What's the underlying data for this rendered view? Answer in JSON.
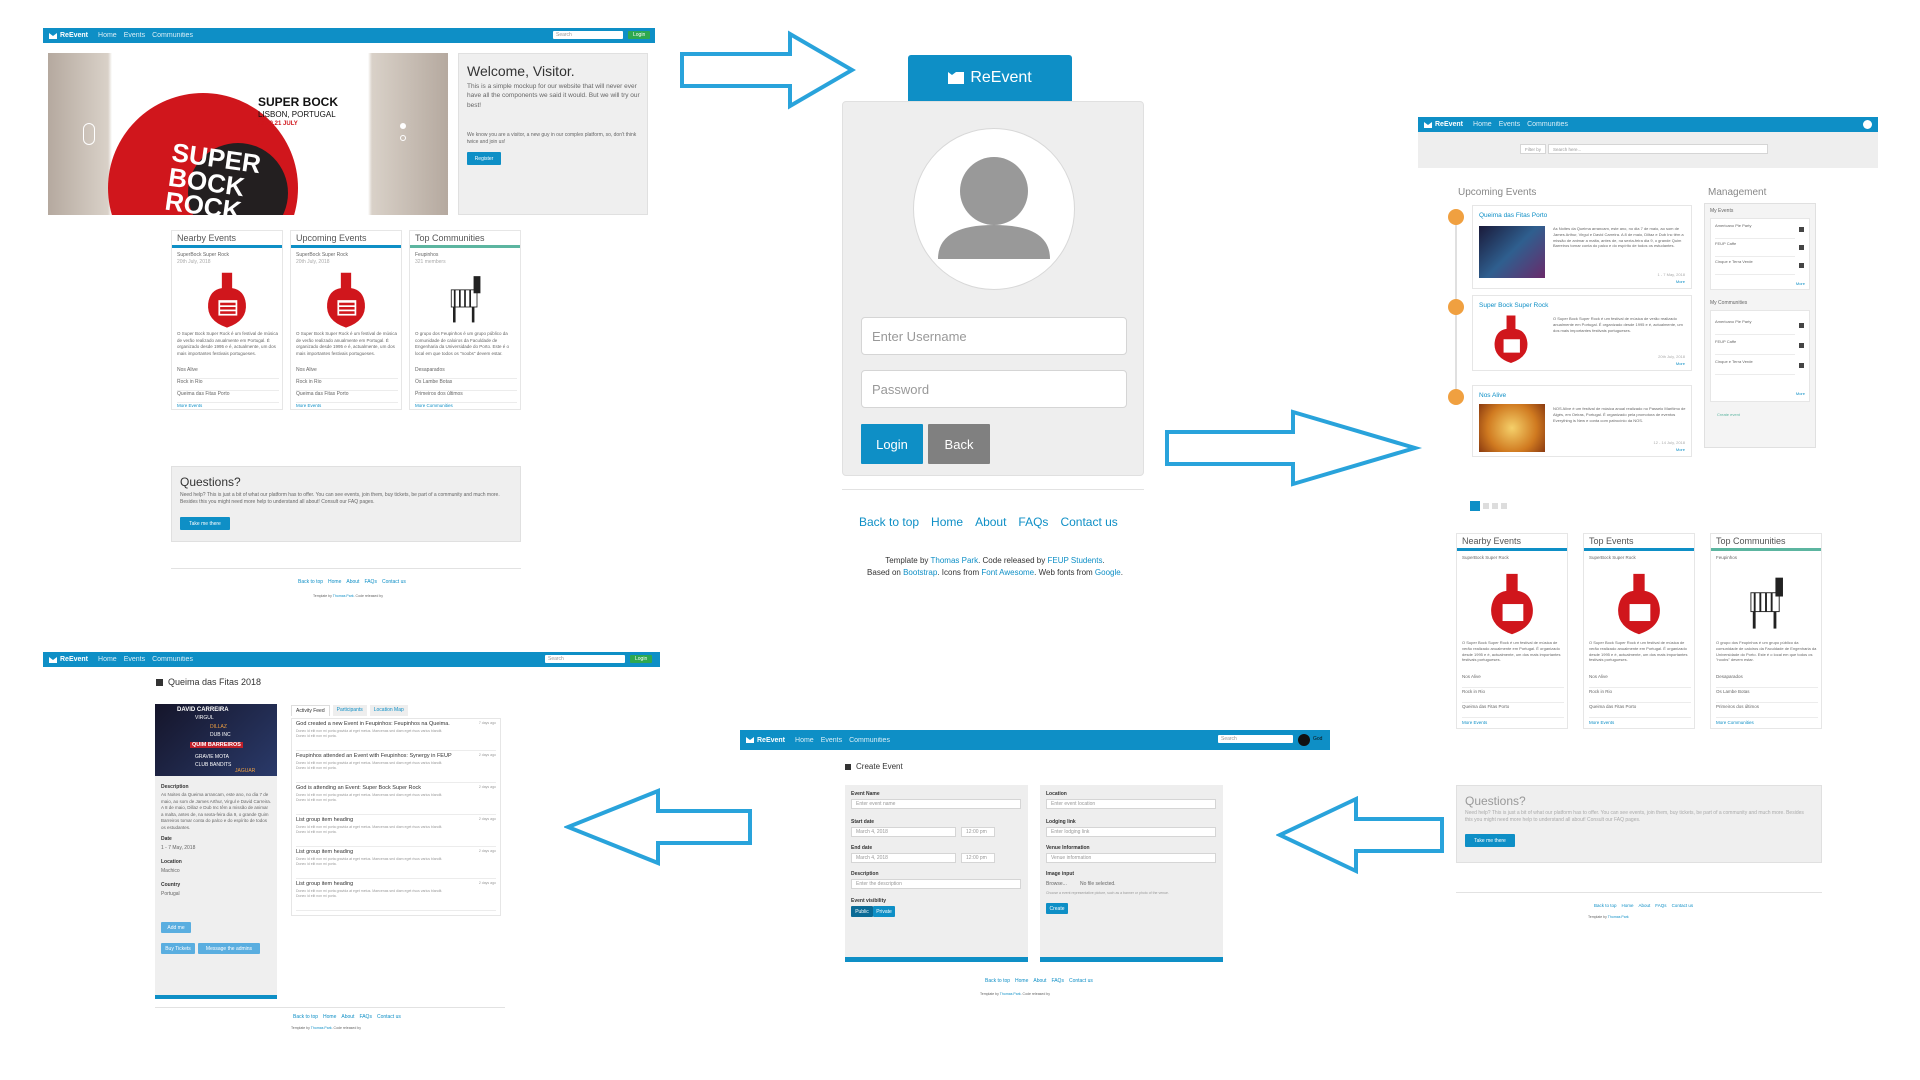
{
  "app": {
    "brand": "ReEvent",
    "nav_links": [
      "Home",
      "Events",
      "Communities"
    ],
    "search_placeholder": "Search",
    "go_label": "Login"
  },
  "home": {
    "hero": {
      "title": "SUPER BOCK",
      "subtitle": "LISBON, PORTUGAL",
      "dates": "19.20.21 JULY",
      "big_text": "SUPER BOCK ROCK"
    },
    "welcome": {
      "title": "Welcome, Visitor.",
      "text": "This is a simple mockup for our website that will never ever have all the components we said it would. But we will try our best!",
      "text2": "We know you are a visitor, a new guy in our complex platform, so, don't think twice and join us!",
      "button": "Register"
    },
    "cards": [
      {
        "title": "Nearby Events",
        "item": "SuperBock Super Rock",
        "date": "20th July, 2018",
        "desc": "O Super Bock Super Rock é um festival de música de verão realizado anualmente em Portugal. É organizado desde 1995 e é, actualmente, um dos mais importantes festivais portugueses.",
        "links": [
          "Nos Alive",
          "Rock in Rio",
          "Queima das Fitas Porto"
        ],
        "more": "More Events"
      },
      {
        "title": "Upcoming Events",
        "item": "SuperBock Super Rock",
        "date": "20th July, 2018",
        "desc": "O Super Bock Super Rock é um festival de música de verão realizado anualmente em Portugal. É organizado desde 1995 e é, actualmente, um dos mais importantes festivais portugueses.",
        "links": [
          "Nos Alive",
          "Rock in Rio",
          "Queima das Fitas Porto"
        ],
        "more": "More Events"
      },
      {
        "title": "Top Communities",
        "item": "Feupinhos",
        "date": "321 members",
        "desc": "O grupo dos Feupinhos é um grupo público da comunidade de caloiros da Faculdade de Engenharia da Universidade do Porto. Este é o local em que todos os \"noobs\" devem estar.",
        "links": [
          "Desaparados",
          "Os Lambe Botas",
          "Primeiros dos últimos"
        ],
        "more": "More Communities"
      }
    ],
    "questions": {
      "title": "Questions?",
      "text": "Need help? This is just a bit of what our platform has to offer. You can see events, join them, buy tickets, be part of a community and much more. Besides this you might need more help to understand all about! Consult our FAQ pages.",
      "button": "Take me there"
    }
  },
  "login": {
    "brand": "ReEvent",
    "username_placeholder": "Enter Username",
    "password_placeholder": "Password",
    "login_button": "Login",
    "back_button": "Back",
    "footer_links": [
      "Back to top",
      "Home",
      "About",
      "FAQs",
      "Contact us"
    ],
    "credit_prefix": "Template by",
    "credit_author": "Thomas Park",
    "credit_mid": ". Code released by",
    "credit_feup": "FEUP Students",
    "credit_line2_a": "Based on",
    "credit_bootstrap": "Bootstrap",
    "credit_line2_b": ". Icons from",
    "credit_fa": "Font Awesome",
    "credit_line2_c": ". Web fonts from",
    "credit_google": "Google"
  },
  "dashboard": {
    "filter": "Filter by",
    "search_placeholder": "Search here...",
    "upcoming_title": "Upcoming Events",
    "management_title": "Management",
    "timeline": [
      {
        "title": "Queima das Fitas Porto",
        "desc": "As Noites da Queima arrancam, este ano, no dia 7 de maio, ao som de James Arthur, Virgul e David Carreira. A 8 de maio, Diltaz e Dub Inc têm a missão de animar a malta, antes de, na sexta-feira dia 9, o grande Quim Barreiros tornar conta do palco e do espírito de todos os estudantes.",
        "date": "1 - 7 May, 2018",
        "more": "More"
      },
      {
        "title": "Super Bock Super Rock",
        "desc": "O Super Bock Super Rock é um festival de música de verão realizado anualmente em Portugal. É organizado desde 1995 e é, actualmente, um dos mais importantes festivais portugueses.",
        "date": "20th July, 2018",
        "more": "More"
      },
      {
        "title": "Nos Alive",
        "desc": "NOS Alive é um festival de música anual realizado no Passeio Marítimo de Algés, em Oeiras, Portugal. É organizado pela promotora de eventos Everything is New e conta com patrocínio da NOS.",
        "date": "12 - 14 July, 2018",
        "more": "More"
      }
    ],
    "my_events_title": "My Events",
    "my_events": [
      "Americano Pie Party",
      "FEUP Caffe",
      "Cinque e Terra Verde"
    ],
    "my_communities_title": "My Communities",
    "my_communities": [
      "Americano Pie Party",
      "FEUP Caffe",
      "Cinque e Terra Verde"
    ],
    "more": "More",
    "create_label": "Create event",
    "cards": [
      "Nearby Events",
      "Top Events",
      "Top Communities"
    ],
    "questions_title": "Questions?",
    "questions_button": "Take me there"
  },
  "event_page": {
    "title": "Queima das Fitas 2018",
    "poster_lines": [
      "DAVID CARREIRA",
      "VIRGUL",
      "DILLAZ",
      "DUB INC",
      "QUIM BARREIROS",
      "GRAVIE MOTA",
      "CLUB BANDITS",
      "JAGUAR"
    ],
    "tabs": [
      "Activity Feed",
      "Participants",
      "Location Map"
    ],
    "feed": [
      {
        "title": "God created a new Event in Feupinhos: Feupinhos na Queima.",
        "time": "7 days ago"
      },
      {
        "title": "Feupinhos attended an Event with Feupinhos: Synergy in FEUP",
        "time": "2 days ago"
      },
      {
        "title": "God is attending an Event: Super Bock Super Rock",
        "time": "2 days ago"
      },
      {
        "title": "List group item heading",
        "time": "2 days ago"
      },
      {
        "title": "List group item heading",
        "time": "2 days ago"
      },
      {
        "title": "List group item heading",
        "time": "2 days ago"
      }
    ],
    "feed_sub": "Donec id elit non mi porta gravida at eget metus. Maecenas sed diam eget risus varius blandit.",
    "feed_sub2": "Donec id elit non mi porta.",
    "desc_label": "Description",
    "desc": "As Noites da Queima arrancam, este ano, no dia 7 de maio, ao som de James Arthur, Virgul e David Carreira. A 8 de maio, Dillaz e Dub Inc têm a missão de animar a malta, antes de, na sexta-feira dia 9, o grande Quim Barreiros tomar conta do palco e do espírito de todos os estudantes.",
    "date_label": "Date",
    "date": "1 - 7 May, 2018",
    "location_label": "Location",
    "location": "Machico",
    "country_label": "Country",
    "country": "Portugal",
    "add_btn": "Add me",
    "buy_btn": "Buy Tickets",
    "msg_btn": "Message the admins"
  },
  "create_event": {
    "title": "Create Event",
    "event_name_label": "Event Name",
    "event_name_placeholder": "Enter event name",
    "start_label": "Start date",
    "start_value": "March 4, 2018",
    "start_time": "12:00 pm",
    "end_label": "End date",
    "end_value": "March 4, 2018",
    "end_time": "12:00 pm",
    "desc_label": "Description",
    "desc_placeholder": "Enter the description",
    "visibility_label": "Event visibility",
    "public": "Public",
    "private": "Private",
    "location_label": "Location",
    "location_placeholder": "Enter event location",
    "lodging_label": "Lodging link",
    "lodging_placeholder": "Enter lodging link",
    "venue_label": "Venue Information",
    "venue_placeholder": "Venue information",
    "image_label": "Image input",
    "browse": "Browse...",
    "no_file": "No file selected.",
    "image_hint": "Choose a event representative picture, such as a banner or photo of the venue.",
    "create_btn": "Create",
    "user": "God"
  },
  "colors": {
    "primary": "#0e8fc6",
    "arrow": "#29a3db",
    "accent_green": "#5cb5a0",
    "success": "#2ea84f",
    "orange": "#f0a040",
    "grey_btn": "#808080"
  }
}
